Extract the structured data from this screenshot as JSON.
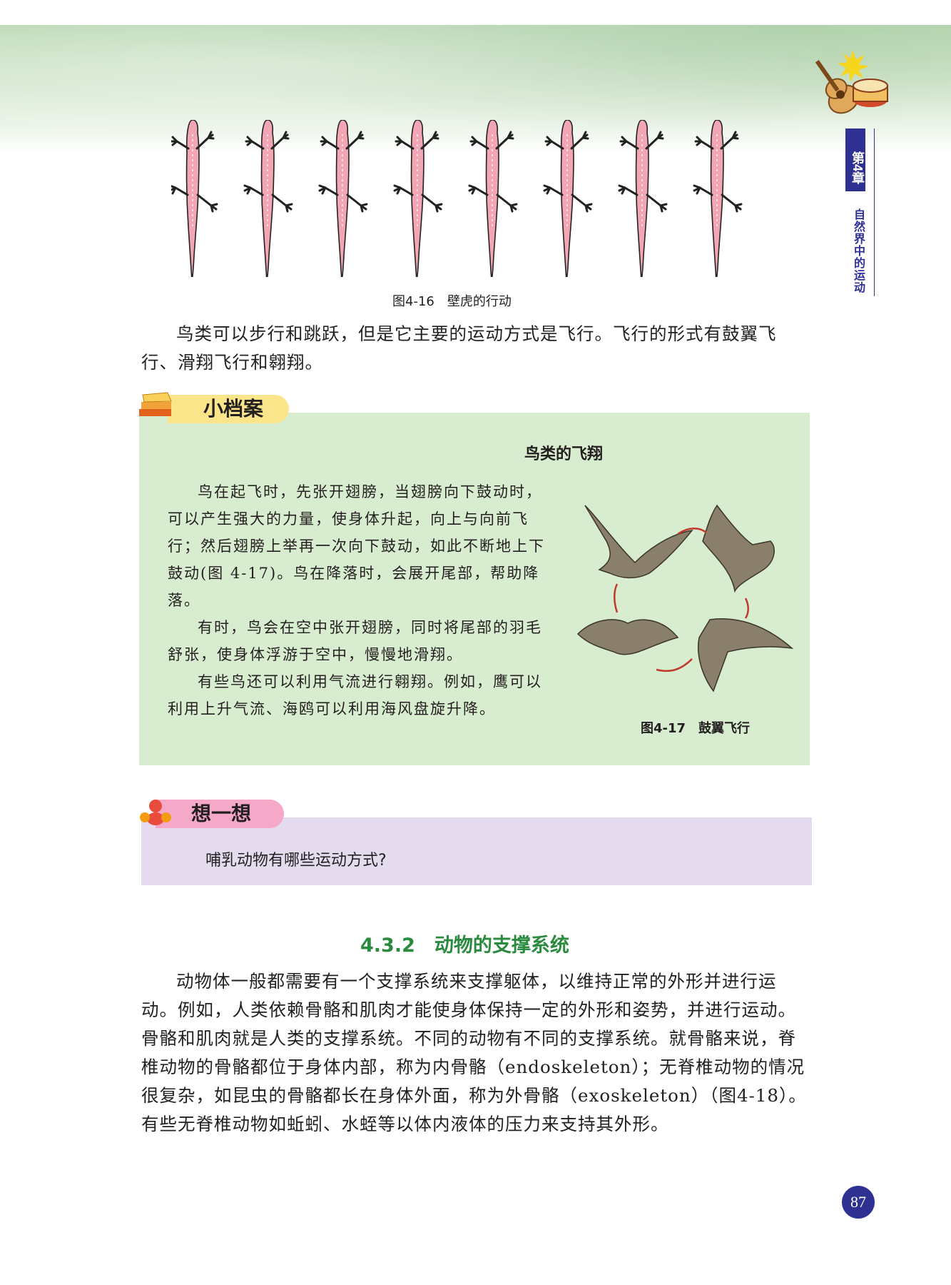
{
  "chapter": {
    "number": "第4章",
    "title": "自然界中的运动"
  },
  "figures": {
    "gecko_caption": "图4-16　壁虎的行动",
    "bird_caption": "图4-17　鼓翼飞行"
  },
  "body": {
    "birds_paragraph": "鸟类可以步行和跳跃，但是它主要的运动方式是飞行。飞行的形式有鼓翼飞行、滑翔飞行和翱翔。"
  },
  "file_box": {
    "label": "小档案",
    "title": "鸟类的飞翔",
    "p1": "鸟在起飞时，先张开翅膀，当翅膀向下鼓动时，可以产生强大的力量，使身体升起，向上与向前飞行；然后翅膀上举再一次向下鼓动，如此不断地上下鼓动(图 4-17)。鸟在降落时，会展开尾部，帮助降落。",
    "p2": "有时，鸟会在空中张开翅膀，同时将尾部的羽毛舒张，使身体浮游于空中，慢慢地滑翔。",
    "p3": "有些鸟还可以利用气流进行翱翔。例如，鹰可以利用上升气流、海鸥可以利用海风盘旋升降。"
  },
  "think_box": {
    "label": "想一想",
    "question": "哺乳动物有哪些运动方式?"
  },
  "section": {
    "heading": "4.3.2　动物的支撑系统",
    "paragraph": "动物体一般都需要有一个支撑系统来支撑躯体，以维持正常的外形并进行运动。例如，人类依赖骨骼和肌肉才能使身体保持一定的外形和姿势，并进行运动。骨骼和肌肉就是人类的支撑系统。不同的动物有不同的支撑系统。就骨骼来说，脊椎动物的骨骼都位于身体内部，称为内骨骼（endoskeleton）；无脊椎动物的情况很复杂，如昆虫的骨骼都长在身体外面，称为外骨骼（exoskeleton）（图4-18）。有些无脊椎动物如蚯蚓、水蛭等以体内液体的压力来支持其外形。"
  },
  "page_number": "87",
  "colors": {
    "accent_blue": "#2e3192",
    "heading_green": "#2a8b3e",
    "file_box_bg": "#d8eccf",
    "think_box_bg": "#e4dcee",
    "gecko_pink": "#f2a6b4"
  }
}
